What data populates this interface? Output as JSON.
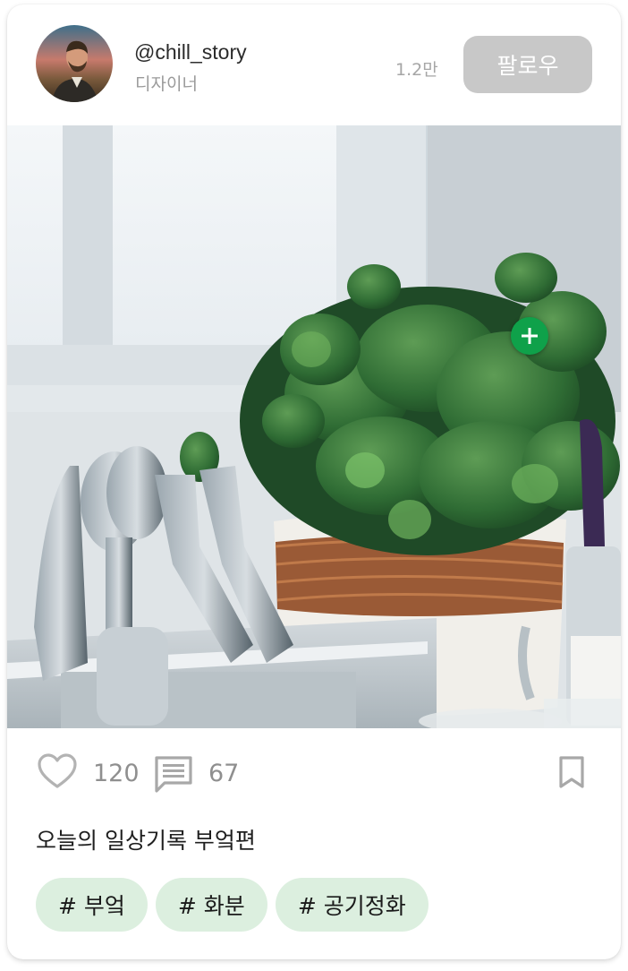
{
  "profile": {
    "username": "@chill_story",
    "role": "디자이너",
    "followers": "1.2만",
    "follow_label": "팔로우"
  },
  "post": {
    "photo_icon": "kitchen-plant-photo",
    "tag_button_icon": "plus-icon",
    "likes": "120",
    "comments": "67",
    "caption": "오늘의 일상기록 부엌편",
    "tags": [
      "# 부엌",
      "# 화분",
      "# 공기정화"
    ]
  },
  "colors": {
    "follow_button": "#c8c8c8",
    "tag_background": "#dcefdf",
    "plus_button": "#0fa14a"
  }
}
